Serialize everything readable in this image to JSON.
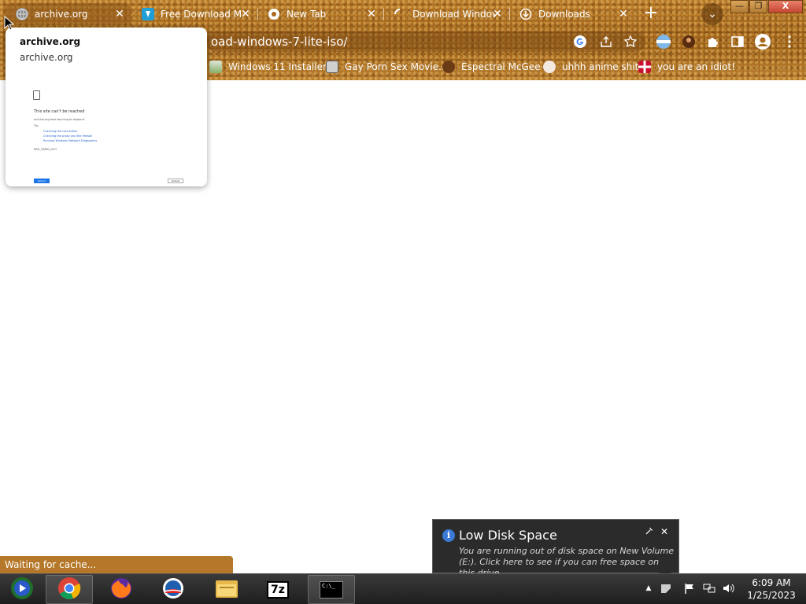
{
  "browser": {
    "tabs": [
      {
        "title": "archive.org",
        "icon": "globe-icon",
        "active": true
      },
      {
        "title": "Free Download M",
        "icon": "download-site-icon",
        "active": false
      },
      {
        "title": "New Tab",
        "icon": "chrome-icon",
        "active": false
      },
      {
        "title": "Download Window",
        "icon": "loading-icon",
        "active": false
      },
      {
        "title": "Downloads",
        "icon": "downloads-icon",
        "active": false
      }
    ],
    "new_tab_symbol": "+",
    "tab_search_symbol": "⌄",
    "close_symbol": "✕",
    "window_controls": {
      "minimize": "—",
      "maximize": "❐",
      "close": "X"
    },
    "url": "oad-windows-7-lite-iso/",
    "bookmarks": [
      {
        "label": "Windows 11 Installer"
      },
      {
        "label": "Gay Porn Sex Movie..."
      },
      {
        "label": "Espectral McGee"
      },
      {
        "label": "uhhh anime shit"
      },
      {
        "label": "you are an idiot!"
      }
    ]
  },
  "hover_card": {
    "title": "archive.org",
    "domain": "archive.org",
    "preview": {
      "message": "This site can't be reached",
      "line1": "archive.org took too long to respond.",
      "line2": "Try:",
      "links": [
        "Checking the connection",
        "Checking the proxy and the firewall",
        "Running Windows Network Diagnostics"
      ],
      "error_code": "ERR_TIMED_OUT",
      "reload": "Reload",
      "details": "Details"
    }
  },
  "status_bubble": "Waiting for cache...",
  "notification": {
    "title": "Low Disk Space",
    "body": "You are running out of disk space on New Volume (E:). Click here to see if you can free space on this drive.",
    "close": "✕"
  },
  "taskbar": {
    "apps": [
      {
        "name": "Windows Media Center",
        "icon": "media-center-icon"
      },
      {
        "name": "Google Chrome",
        "icon": "chrome-icon"
      },
      {
        "name": "Firefox",
        "icon": "firefox-icon"
      },
      {
        "name": "Obama",
        "icon": "obama-logo-icon"
      },
      {
        "name": "File Explorer",
        "icon": "folder-icon"
      },
      {
        "name": "7-Zip",
        "icon": "7zip-icon",
        "label": "7z"
      },
      {
        "name": "Command Prompt",
        "icon": "cmd-icon",
        "label": "C:\\_"
      }
    ],
    "clock_time": "6:09 AM",
    "clock_date": "1/25/2023"
  },
  "colors": {
    "chrome_theme": "#a86a1c",
    "taskbar": "#1e1e1e",
    "balloon": "#2b2b2b",
    "accent_blue": "#1a73e8"
  }
}
